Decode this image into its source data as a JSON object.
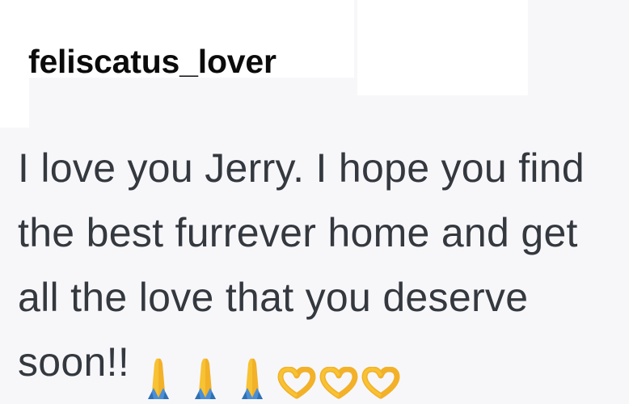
{
  "comment": {
    "username": "feliscatus_lover",
    "text": "I love you Jerry. I hope you find the best furrever home and get all the love that you deserve soon!!"
  },
  "emojis": [
    {
      "name": "folded-hands-icon",
      "glyph": "🙏"
    },
    {
      "name": "folded-hands-icon",
      "glyph": "🙏"
    },
    {
      "name": "folded-hands-icon",
      "glyph": "🙏"
    },
    {
      "name": "heart-hands-icon",
      "glyph": "🫶"
    },
    {
      "name": "heart-hands-icon",
      "glyph": "🫶"
    },
    {
      "name": "heart-hands-icon",
      "glyph": "🫶"
    }
  ]
}
